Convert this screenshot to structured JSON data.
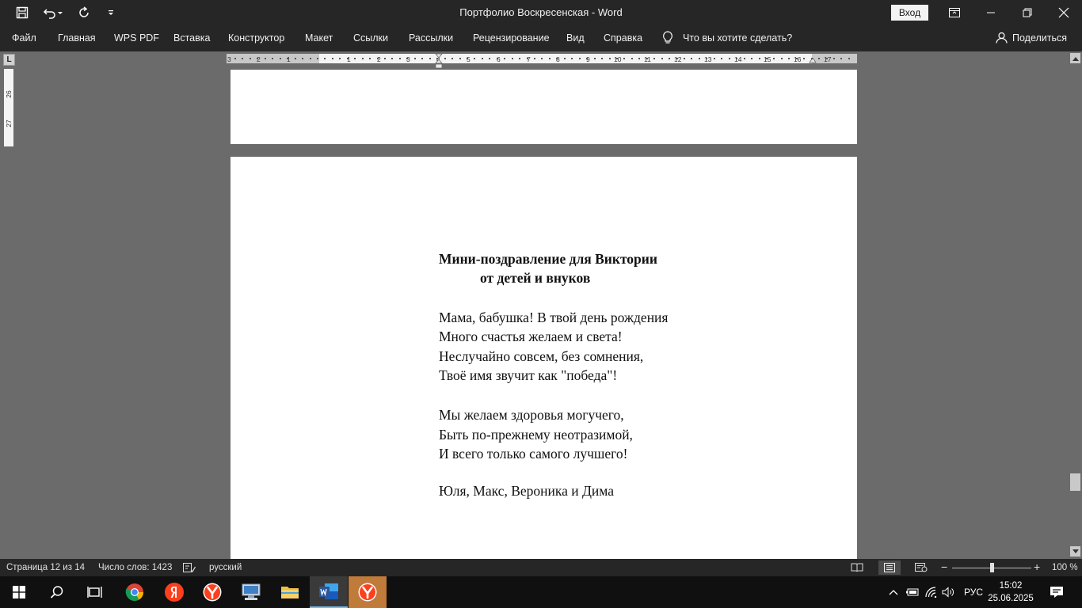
{
  "window": {
    "title": "Портфолио Воскресенская  -  Word",
    "signin_label": "Вход"
  },
  "ribbon": {
    "tabs": [
      "Файл",
      "Главная",
      "WPS PDF",
      "Вставка",
      "Конструктор",
      "Макет",
      "Ссылки",
      "Рассылки",
      "Рецензирование",
      "Вид",
      "Справка"
    ],
    "tell_me": "Что вы хотите сделать?",
    "share_label": "Поделиться"
  },
  "ruler": {
    "corner_label": "L",
    "horizontal_ticks": [
      "3",
      "2",
      "1",
      "1",
      "2",
      "3",
      "4",
      "5",
      "6",
      "7",
      "8",
      "9",
      "10",
      "11",
      "12",
      "13",
      "14",
      "15",
      "16",
      "17"
    ],
    "vertical_ticks": [
      "26",
      "27"
    ]
  },
  "document": {
    "title_line1": "Мини-поздравление для Виктории",
    "title_line2": "от детей и внуков",
    "stanza1": [
      "Мама, бабушка! В твой день рождения",
      "Много счастья желаем и света!",
      "Неслучайно совсем, без сомнения,",
      "Твоё имя звучит как \"победа\"!"
    ],
    "stanza2": [
      "Мы желаем здоровья могучего,",
      "Быть по-прежнему неотразимой,",
      "И всего только самого лучшего!"
    ],
    "signature": "Юля, Макс, Вероника и Дима"
  },
  "status": {
    "page": "Страница 12 из 14",
    "words": "Число слов: 1423",
    "language": "русский",
    "zoom_minus": "−",
    "zoom_plus": "+",
    "zoom_level": "100 %",
    "zoom_fraction": 0.5
  },
  "taskbar": {
    "language": "РУС",
    "time": "15:02",
    "date": "25.06.2025"
  },
  "colors": {
    "chrome_dark": "#262626",
    "canvas": "#6b6b6b",
    "word_blue": "#2b579a",
    "yandex_red": "#fc3f1d"
  }
}
